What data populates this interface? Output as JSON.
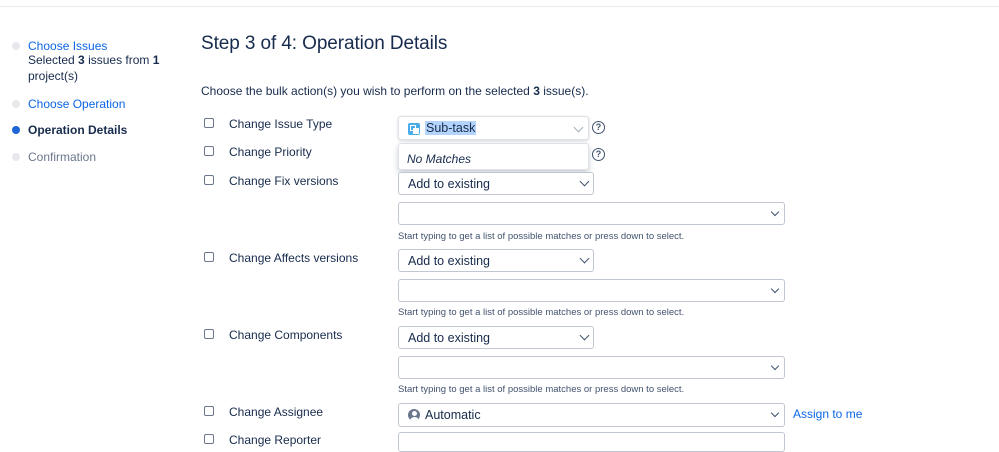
{
  "sidebar": {
    "steps": [
      {
        "label": "Choose Issues",
        "state": "link"
      },
      {
        "label": "Choose Operation",
        "state": "link"
      },
      {
        "label": "Operation Details",
        "state": "current"
      },
      {
        "label": "Confirmation",
        "state": "future"
      }
    ],
    "selection": {
      "prefix": "Selected",
      "count": "3",
      "middle": "issues from",
      "projects": "1",
      "suffix": "project(s)"
    }
  },
  "main": {
    "title": "Step 3 of 4: Operation Details",
    "intro": {
      "prefix": "Choose the bulk action(s) you wish to perform on the selected",
      "count": "3",
      "suffix": "issue(s)."
    },
    "operations": {
      "issue_type": {
        "label": "Change Issue Type",
        "value": "Sub-task",
        "dropdown_message": "No Matches"
      },
      "priority": {
        "label": "Change Priority"
      },
      "fix_versions": {
        "label": "Change Fix versions",
        "mode": "Add to existing",
        "input_value": "",
        "hint": "Start typing to get a list of possible matches or press down to select."
      },
      "affects_versions": {
        "label": "Change Affects versions",
        "mode": "Add to existing",
        "input_value": "",
        "hint": "Start typing to get a list of possible matches or press down to select."
      },
      "components": {
        "label": "Change Components",
        "mode": "Add to existing",
        "input_value": "",
        "hint": "Start typing to get a list of possible matches or press down to select."
      },
      "assignee": {
        "label": "Change Assignee",
        "value": "Automatic",
        "assign_to_me": "Assign to me"
      },
      "reporter": {
        "label": "Change Reporter"
      }
    },
    "help_glyph": "?"
  },
  "icons": {
    "subtask": "subtask-icon",
    "user": "user-avatar-icon",
    "help": "help-icon",
    "chevron": "chevron-down-icon"
  },
  "colors": {
    "link": "#0c66e4",
    "current_step": "#1d64d8",
    "text": "#172b4d",
    "selection_highlight": "#b3d4fc",
    "subtask_icon": "#4bade8"
  }
}
